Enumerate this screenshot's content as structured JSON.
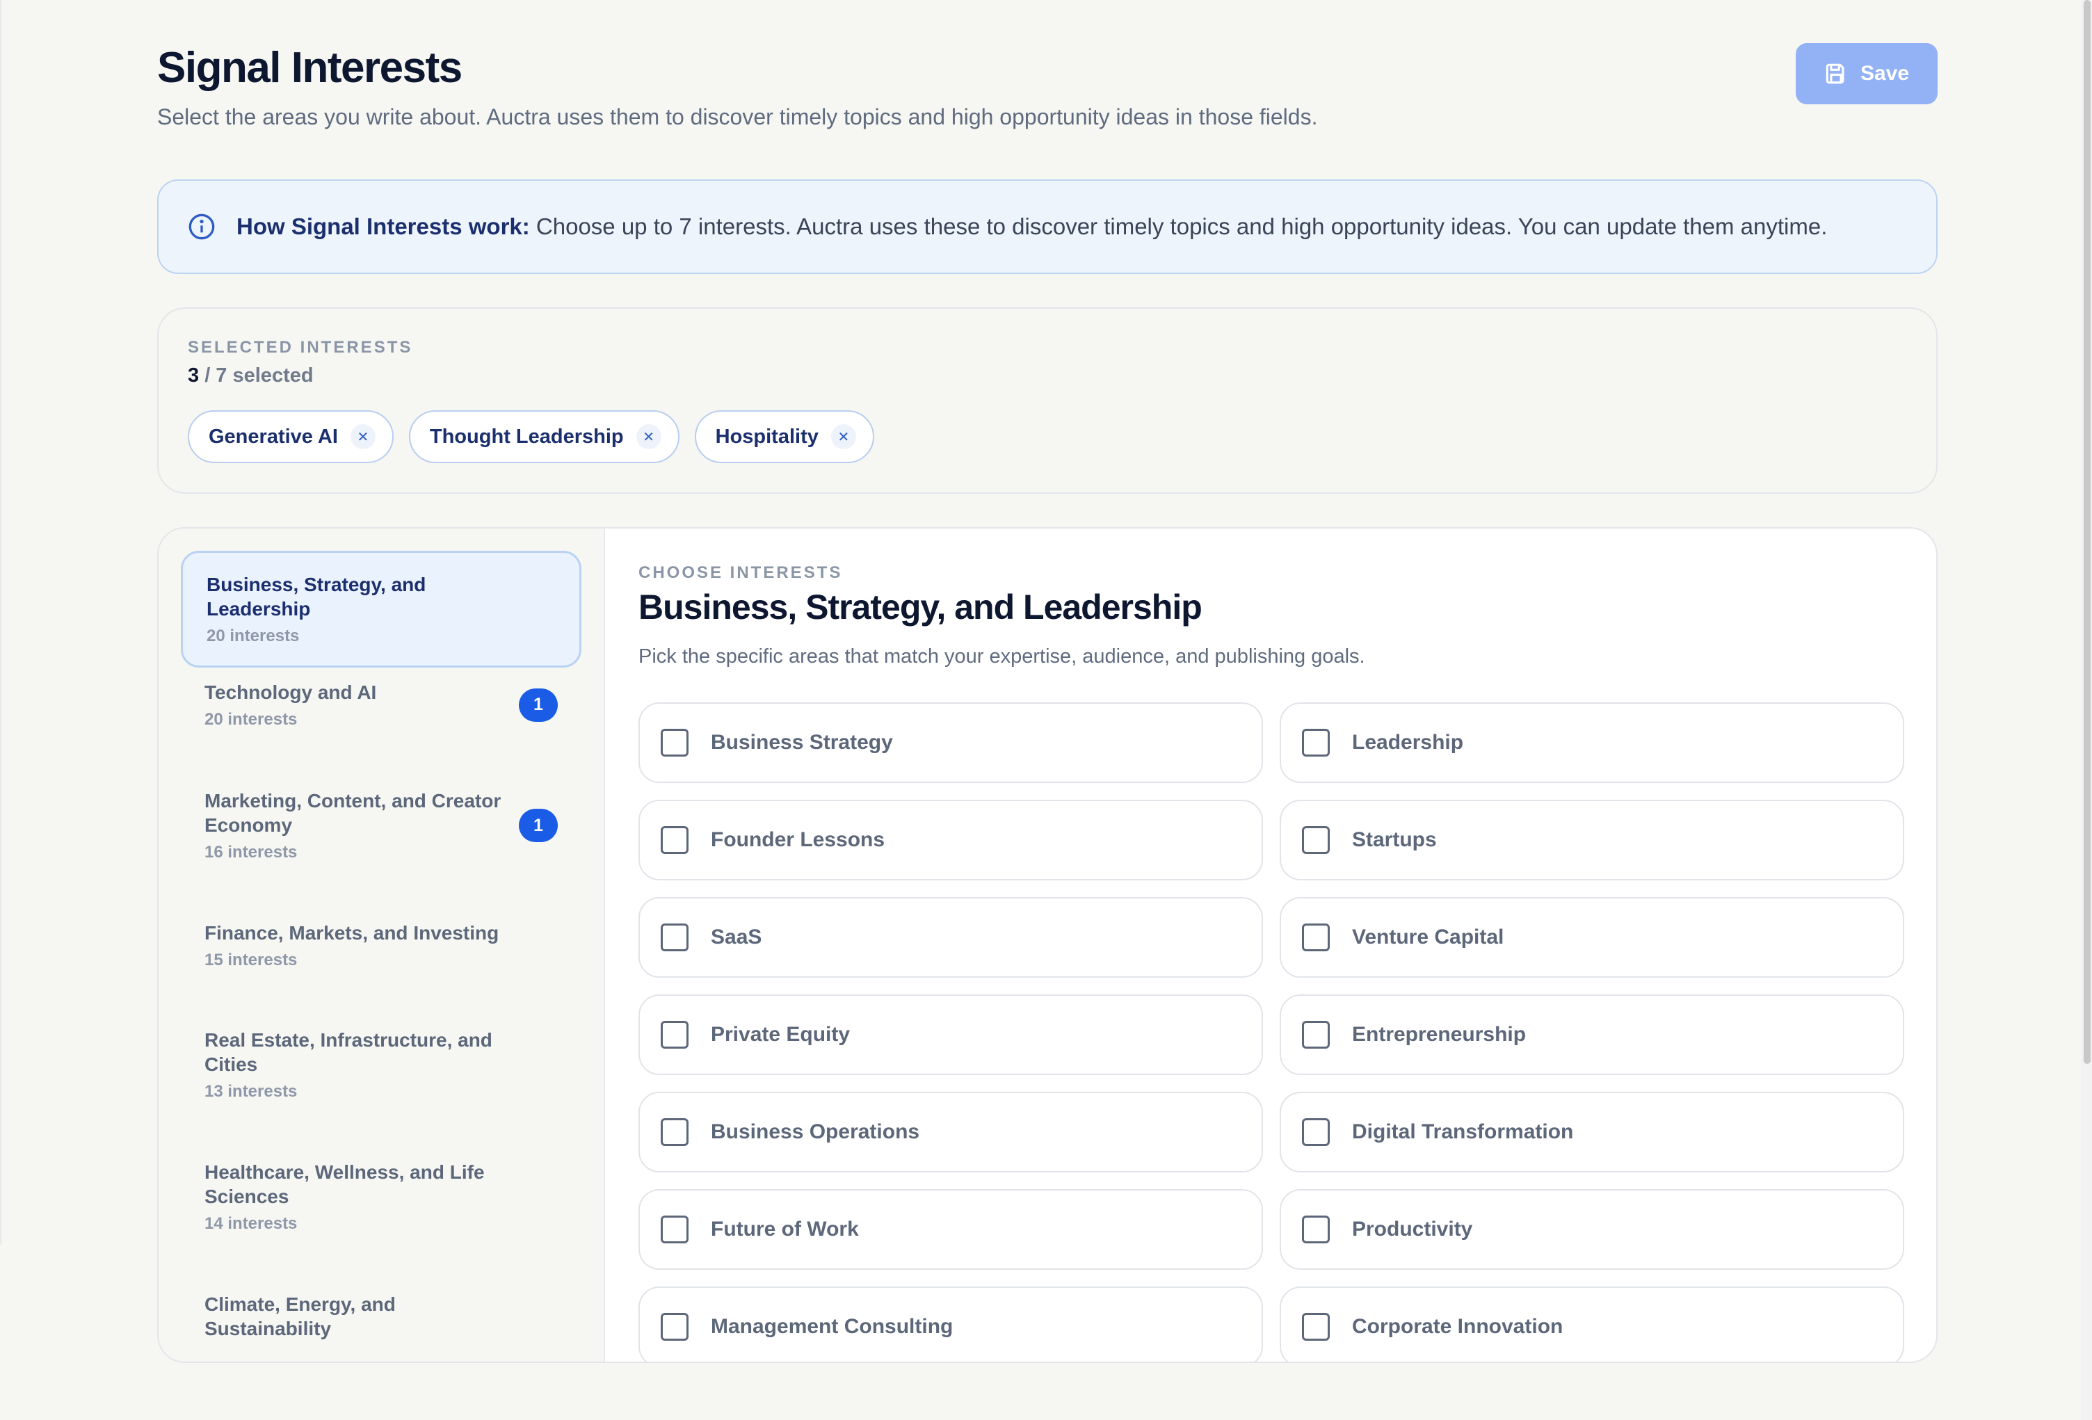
{
  "header": {
    "title": "Signal Interests",
    "subtitle": "Select the areas you write about. Auctra uses them to discover timely topics and high opportunity ideas in those fields.",
    "save_label": "Save"
  },
  "info": {
    "bold": "How Signal Interests work:",
    "text": " Choose up to 7 interests. Auctra uses these to discover timely topics and high opportunity ideas. You can update them anytime."
  },
  "selected": {
    "label": "SELECTED INTERESTS",
    "count": "3",
    "of_text": " / 7 selected",
    "chips": [
      "Generative AI",
      "Thought Leadership",
      "Hospitality"
    ]
  },
  "sidebar": {
    "categories": [
      {
        "name": "Business, Strategy, and Leadership",
        "count": "20 interests",
        "badge": ""
      },
      {
        "name": "Technology and AI",
        "count": "20 interests",
        "badge": "1"
      },
      {
        "name": "Marketing, Content, and Creator Economy",
        "count": "16 interests",
        "badge": "1"
      },
      {
        "name": "Finance, Markets, and Investing",
        "count": "15 interests",
        "badge": ""
      },
      {
        "name": "Real Estate, Infrastructure, and Cities",
        "count": "13 interests",
        "badge": ""
      },
      {
        "name": "Healthcare, Wellness, and Life Sciences",
        "count": "14 interests",
        "badge": ""
      },
      {
        "name": "Climate, Energy, and Sustainability",
        "count": "",
        "badge": ""
      }
    ]
  },
  "content": {
    "label": "CHOOSE INTERESTS",
    "title": "Business, Strategy, and Leadership",
    "description": "Pick the specific areas that match your expertise, audience, and publishing goals.",
    "options": [
      "Business Strategy",
      "Leadership",
      "Founder Lessons",
      "Startups",
      "SaaS",
      "Venture Capital",
      "Private Equity",
      "Entrepreneurship",
      "Business Operations",
      "Digital Transformation",
      "Future of Work",
      "Productivity",
      "Management Consulting",
      "Corporate Innovation"
    ]
  },
  "colors": {
    "accent": "#1a5ce6",
    "save_button": "#93b2f5",
    "info_background": "#edf4fb"
  },
  "icons": [
    "save-icon",
    "info-icon",
    "close-icon",
    "checkbox-icon"
  ]
}
